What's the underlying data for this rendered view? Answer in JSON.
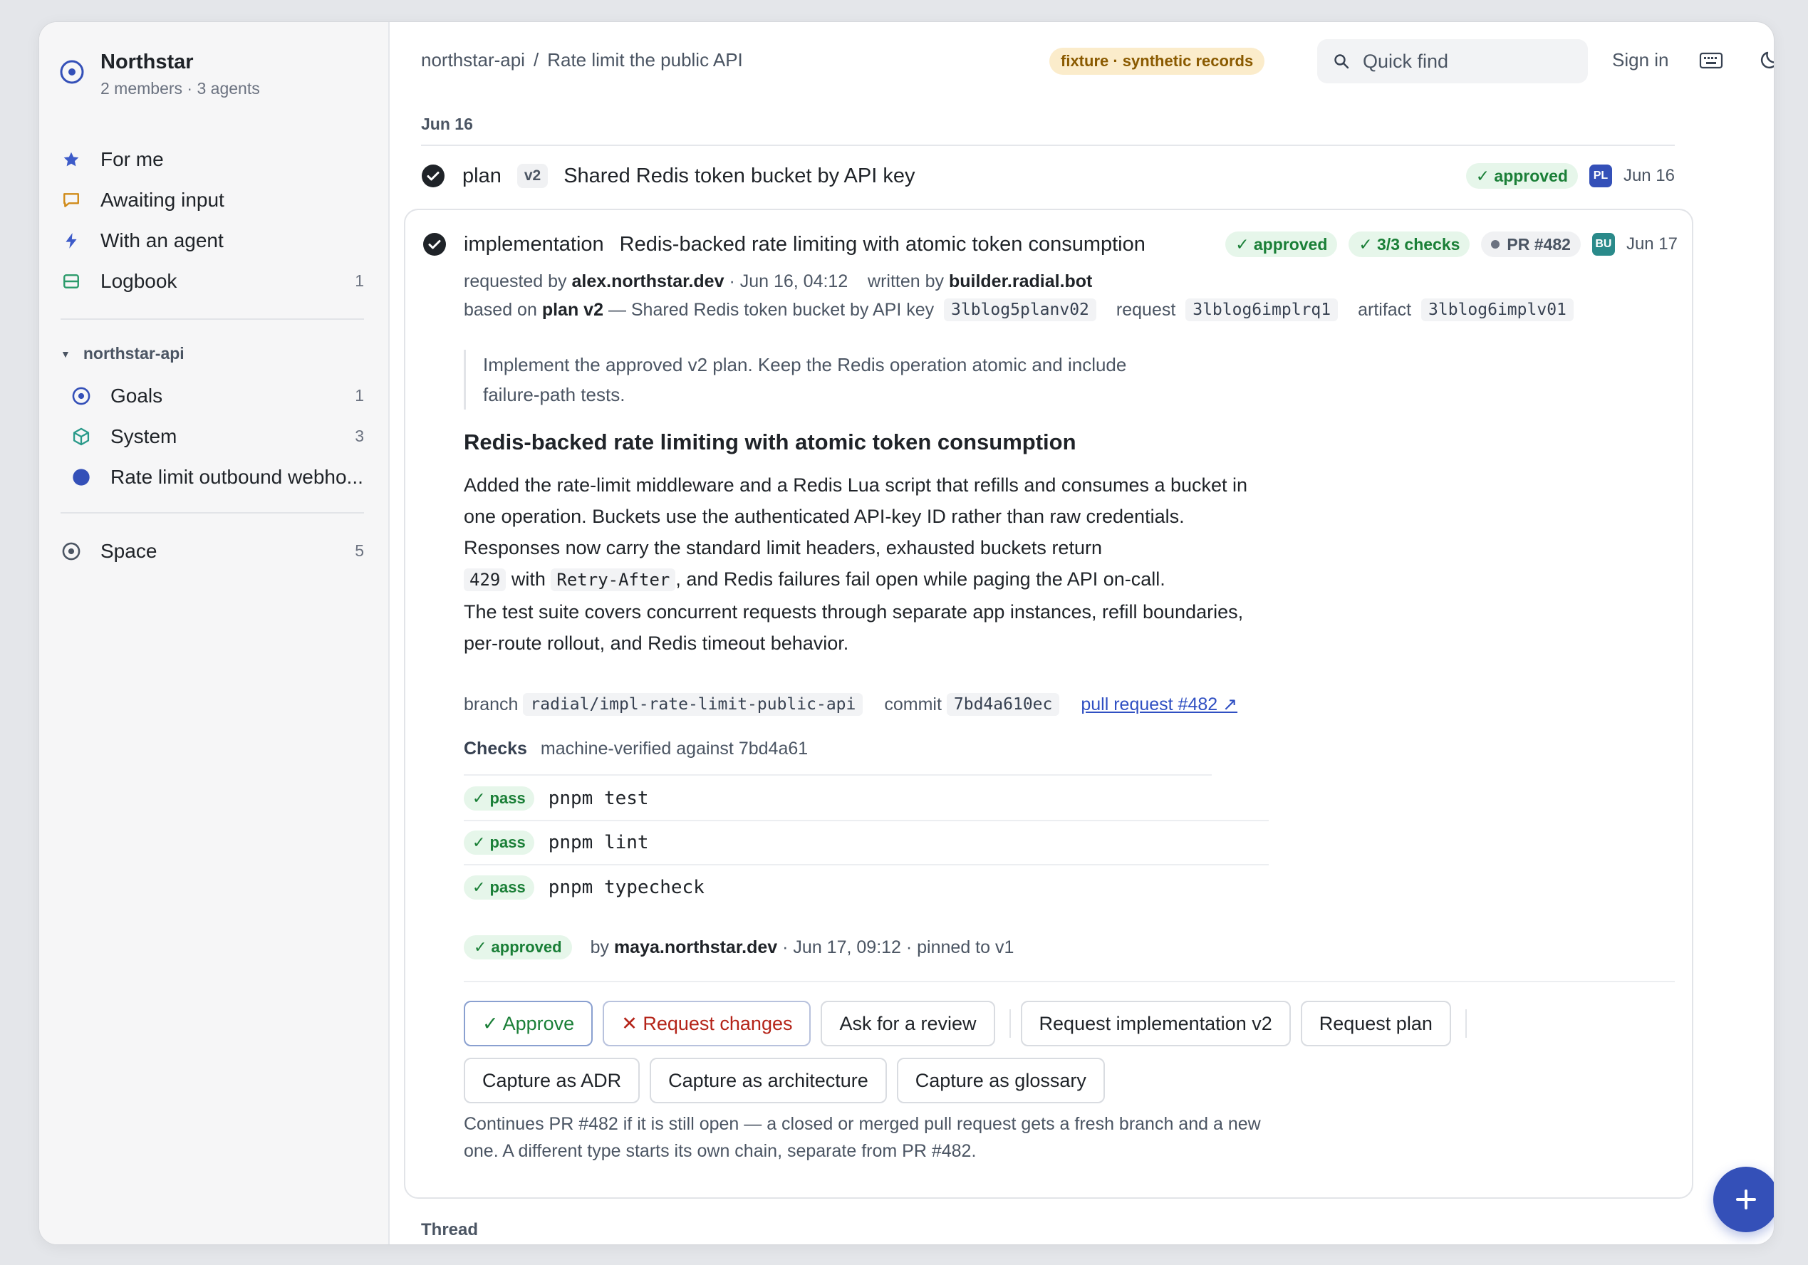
{
  "workspace": {
    "name": "Northstar",
    "subtitle": "2 members · 3 agents"
  },
  "sidebar": {
    "primary": [
      {
        "label": "For me",
        "count": "",
        "icon": "star-icon"
      },
      {
        "label": "Awaiting input",
        "count": "",
        "icon": "chat-bubble-icon"
      },
      {
        "label": "With an agent",
        "count": "",
        "icon": "lightning-icon"
      },
      {
        "label": "Logbook",
        "count": "1",
        "icon": "logbook-icon"
      }
    ],
    "project": {
      "name": "northstar-api",
      "items": [
        {
          "label": "Goals",
          "count": "1",
          "icon": "target-icon"
        },
        {
          "label": "System",
          "count": "3",
          "icon": "cube-icon"
        },
        {
          "label": "Rate limit outbound webho...",
          "count": "",
          "icon": "dot-icon"
        }
      ]
    },
    "space": {
      "label": "Space",
      "count": "5",
      "icon": "space-icon"
    }
  },
  "topbar": {
    "breadcrumb_project": "northstar-api",
    "breadcrumb_sep": "/",
    "breadcrumb_page": "Rate limit the public API",
    "fixture_badge": "fixture · synthetic records",
    "search_placeholder": "Quick find",
    "sign_in": "Sign in"
  },
  "timeline": {
    "date_header": "Jun 16",
    "plan_row": {
      "kind": "plan",
      "version": "v2",
      "title": "Shared Redis token bucket by API key",
      "status": "✓ approved",
      "avatar": "PL",
      "date": "Jun 16"
    },
    "implementation": {
      "kind": "implementation",
      "title": "Redis-backed rate limiting with atomic token consumption",
      "status": "✓ approved",
      "checks_badge": "✓ 3/3 checks",
      "pr_badge": "PR #482",
      "avatar": "BU",
      "date": "Jun 17",
      "requested_by_label": "requested by",
      "requested_by": "alex.northstar.dev",
      "requested_at": "· Jun 16, 04:12",
      "written_by_label": "written by",
      "written_by": "builder.radial.bot",
      "based_on_label": "based on",
      "based_on_plan": "plan v2",
      "based_on_title": "— Shared Redis token bucket by API key",
      "plan_id": "3lblog5planv02",
      "request_label": "request",
      "request_id": "3lblog6implrq1",
      "artifact_label": "artifact",
      "artifact_id": "3lblog6implv01",
      "instruction": "Implement the approved v2 plan. Keep the Redis operation atomic and include failure-path tests.",
      "heading": "Redis-backed rate limiting with atomic token consumption",
      "body1_a": "Added the rate-limit middleware and a Redis Lua script that refills and consumes a bucket in one operation. Buckets use the authenticated API-key ID rather than raw credentials. Responses now carry the standard limit headers, exhausted buckets return",
      "body1_code1": "429",
      "body1_b": "with",
      "body1_code2": "Retry-After",
      "body1_c": ", and Redis failures fail open while paging the API on-call.",
      "body2": "The test suite covers concurrent requests through separate app instances, refill boundaries, per-route rollout, and Redis timeout behavior.",
      "branch_label": "branch",
      "branch": "radial/impl-rate-limit-public-api",
      "commit_label": "commit",
      "commit": "7bd4a610ec",
      "pr_link": "pull request #482 ↗",
      "checks_title": "Checks",
      "checks_sub": "machine-verified against 7bd4a61",
      "checks": [
        {
          "status": "✓ pass",
          "command": "pnpm test"
        },
        {
          "status": "✓ pass",
          "command": "pnpm lint"
        },
        {
          "status": "✓ pass",
          "command": "pnpm typecheck"
        }
      ],
      "approval_badge": "✓ approved",
      "approval_by_label": "by",
      "approval_by": "maya.northstar.dev",
      "approval_meta": "· Jun 17, 09:12 · pinned to v1",
      "actions_row1": {
        "approve": "✓ Approve",
        "request_changes": "✕ Request changes",
        "ask_review": "Ask for a review",
        "request_impl_v2": "Request implementation v2",
        "request_plan": "Request plan"
      },
      "actions_row2": {
        "capture_adr": "Capture as ADR",
        "capture_arch": "Capture as architecture",
        "capture_glossary": "Capture as glossary"
      },
      "footnote": "Continues PR #482 if it is still open — a closed or merged pull request gets a fresh branch and a new one. A different type starts its own chain, separate from PR #482."
    },
    "thread_label": "Thread"
  },
  "colors": {
    "accent": "#3450b8",
    "approved_bg": "#e6f6ea",
    "approved_fg": "#1a7f37",
    "fixture_bg": "#fbeccb",
    "fixture_fg": "#8a5a00",
    "reject_fg": "#b42318"
  }
}
